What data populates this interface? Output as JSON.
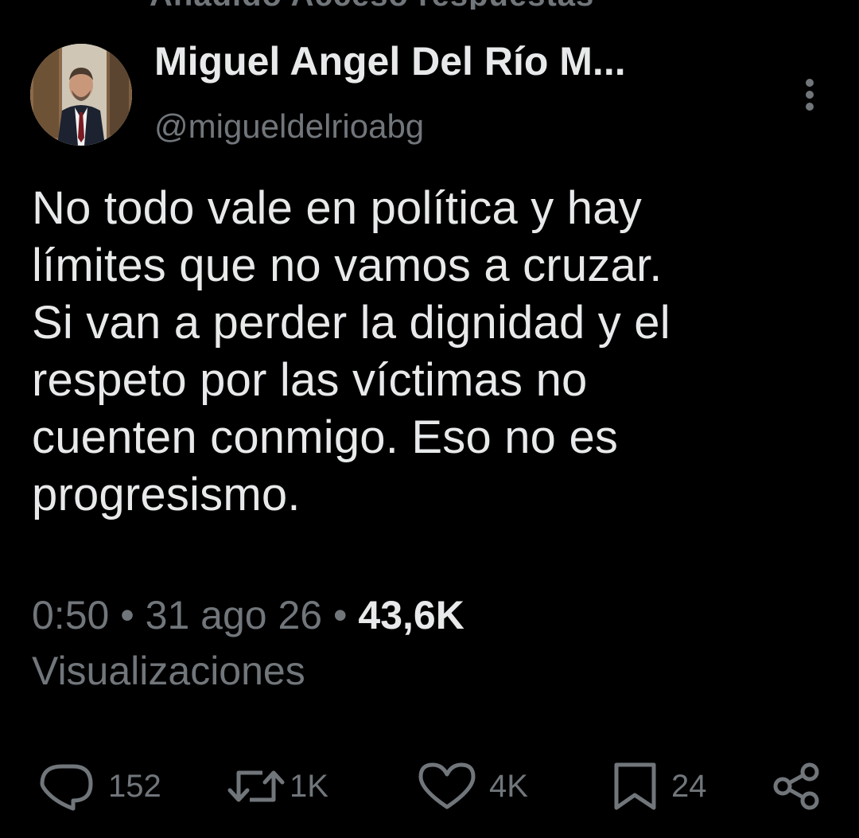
{
  "cut_off_line": "Añadido Acceso respuestas",
  "author": {
    "name": "Miguel Angel Del Río M...",
    "handle": "@migueldelrioabg"
  },
  "tweet": {
    "lines": [
      "No todo vale en política y hay",
      "límites que no vamos a cruzar.",
      "Si van a perder la dignidad y el",
      "respeto por las víctimas no",
      "cuenten conmigo. Eso no es",
      "progresismo."
    ]
  },
  "meta": {
    "time": "0:50",
    "separator": "•",
    "date": "31 ago 26",
    "views_count": "43,6K",
    "views_label": "Visualizaciones"
  },
  "actions": {
    "reply": {
      "icon": "reply-icon",
      "count": "152"
    },
    "repost": {
      "icon": "repost-icon",
      "count": "1K"
    },
    "like": {
      "icon": "heart-icon",
      "count": "4K"
    },
    "bookmark": {
      "icon": "bookmark-icon",
      "count": "24"
    },
    "share": {
      "icon": "share-icon"
    }
  },
  "colors": {
    "background": "#000000",
    "primary_text": "#e7e9ea",
    "secondary_text": "#71767b"
  }
}
